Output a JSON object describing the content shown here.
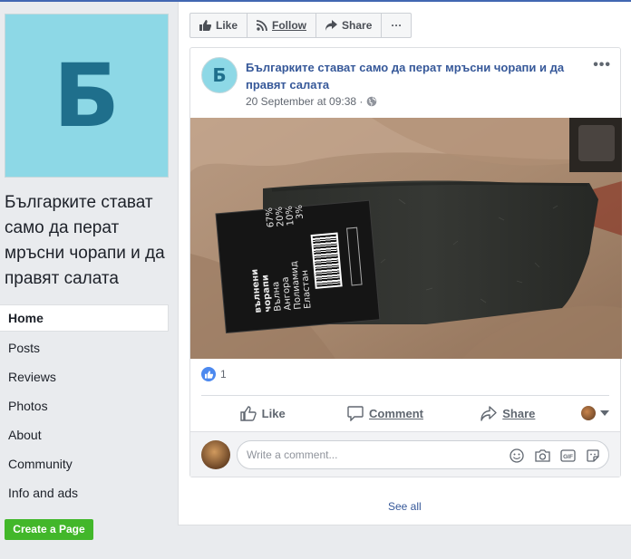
{
  "page": {
    "initial": "Б",
    "name": "Българките стават само да перат мръсни чорапи и да правят салата"
  },
  "nav": {
    "items": [
      {
        "label": "Home",
        "active": true
      },
      {
        "label": "Posts"
      },
      {
        "label": "Reviews"
      },
      {
        "label": "Photos"
      },
      {
        "label": "About"
      },
      {
        "label": "Community"
      },
      {
        "label": "Info and ads"
      }
    ]
  },
  "create_page_label": "Create a Page",
  "actionbar": {
    "like": "Like",
    "follow": "Follow",
    "share": "Share",
    "more": "···"
  },
  "post": {
    "initial": "Б",
    "title": "Българките стават само да перат мръсни чорапи и да правят салата",
    "date": "20 September at 09:38 ·",
    "more": "•••",
    "photo_label": {
      "line1": "вълнени",
      "line2": "чорапи",
      "rows": [
        {
          "name": "Вълна",
          "pct": "67%"
        },
        {
          "name": "Ангора",
          "pct": "20%"
        },
        {
          "name": "Полиамид",
          "pct": "10%"
        },
        {
          "name": "Еластан",
          "pct": "3%"
        }
      ]
    },
    "reaction_count": "1",
    "actions": {
      "like": "Like",
      "comment": "Comment",
      "share": "Share"
    },
    "comment_placeholder": "Write a comment..."
  },
  "see_all": "See all",
  "colors": {
    "brand_blue": "#4267b2",
    "link_blue": "#365899",
    "green": "#42b72a",
    "page_avatar_bg": "#8dd8e6",
    "page_avatar_fg": "#1f6f8c"
  }
}
